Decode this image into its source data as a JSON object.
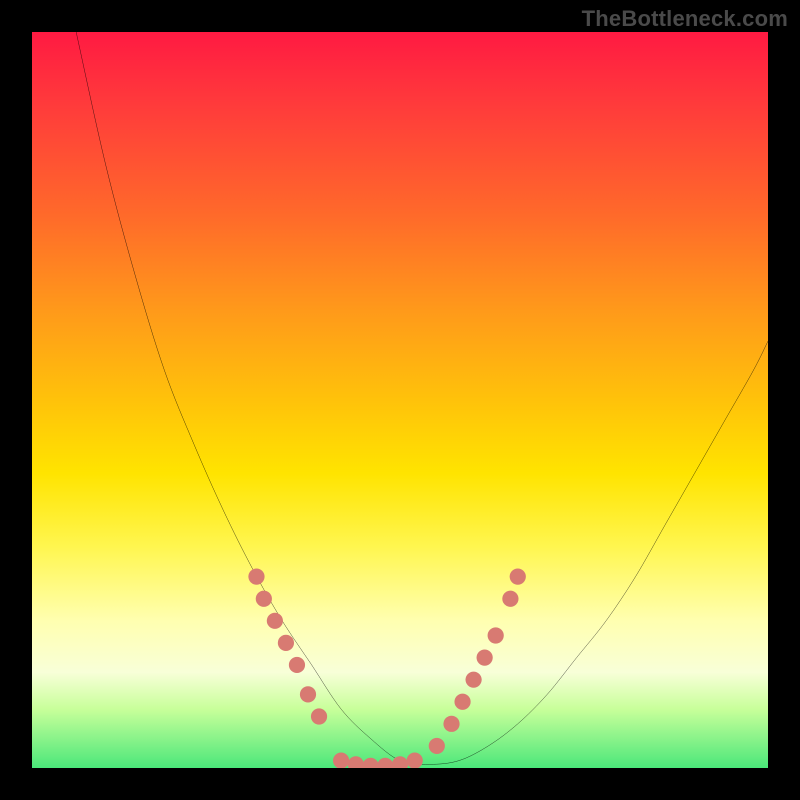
{
  "watermark": {
    "text": "TheBottleneck.com"
  },
  "colors": {
    "background": "#000000",
    "curve_stroke": "#000000",
    "marker_fill": "#d87a72",
    "gradient_stops": [
      "#ff1a42",
      "#ff3b3b",
      "#ff6a2a",
      "#ff9a1a",
      "#ffc20a",
      "#ffe400",
      "#fff650",
      "#ffffb0",
      "#f8ffd8",
      "#c8ff9a",
      "#4be77a"
    ]
  },
  "chart_data": {
    "type": "line",
    "title": "",
    "xlabel": "",
    "ylabel": "",
    "xlim": [
      0,
      100
    ],
    "ylim": [
      0,
      100
    ],
    "grid": false,
    "note": "Axes are unlabeled; values are pixel-space estimates on a 100×100 normalized plot area. y=0 is the top edge of the plot (so high y means near bottom). The curve is a V-shaped potential that reaches the bottom (green) band around x≈40–50 and rises toward both sides.",
    "series": [
      {
        "name": "curve",
        "x": [
          6,
          10,
          14,
          18,
          22,
          26,
          30,
          34,
          38,
          42,
          46,
          50,
          54,
          58,
          62,
          66,
          70,
          74,
          78,
          82,
          86,
          90,
          94,
          98,
          100
        ],
        "y": [
          0,
          18,
          33,
          46,
          56,
          65,
          73,
          80,
          86,
          92,
          96,
          99,
          99.5,
          99,
          97,
          94,
          90,
          85,
          80,
          74,
          67,
          60,
          53,
          46,
          42
        ]
      }
    ],
    "markers": {
      "name": "highlight-dots",
      "color": "#d87a72",
      "points": [
        {
          "x": 30.5,
          "y": 74
        },
        {
          "x": 31.5,
          "y": 77
        },
        {
          "x": 33.0,
          "y": 80
        },
        {
          "x": 34.5,
          "y": 83
        },
        {
          "x": 36.0,
          "y": 86
        },
        {
          "x": 37.5,
          "y": 90
        },
        {
          "x": 39.0,
          "y": 93
        },
        {
          "x": 42.0,
          "y": 99
        },
        {
          "x": 44.0,
          "y": 99.5
        },
        {
          "x": 46.0,
          "y": 99.7
        },
        {
          "x": 48.0,
          "y": 99.7
        },
        {
          "x": 50.0,
          "y": 99.5
        },
        {
          "x": 52.0,
          "y": 99
        },
        {
          "x": 55.0,
          "y": 97
        },
        {
          "x": 57.0,
          "y": 94
        },
        {
          "x": 58.5,
          "y": 91
        },
        {
          "x": 60.0,
          "y": 88
        },
        {
          "x": 61.5,
          "y": 85
        },
        {
          "x": 63.0,
          "y": 82
        },
        {
          "x": 65.0,
          "y": 77
        },
        {
          "x": 66.0,
          "y": 74
        }
      ]
    }
  }
}
